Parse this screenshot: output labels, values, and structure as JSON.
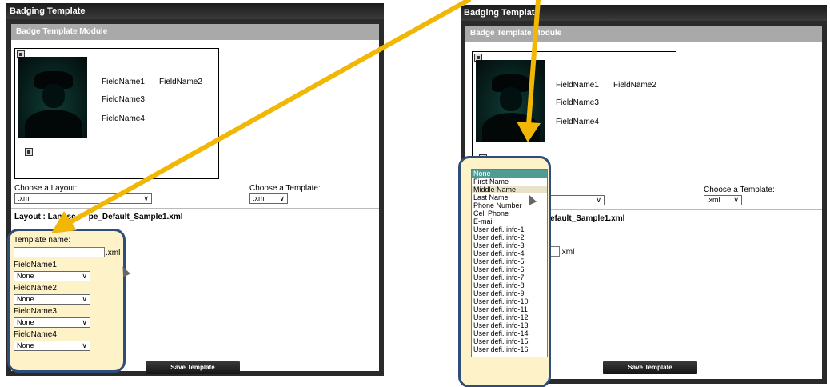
{
  "window_title": "Badging Template",
  "module_title": "Badge Template Module",
  "field_names": [
    "FieldName1",
    "FieldName2",
    "FieldName3",
    "FieldName4"
  ],
  "layout_label": "Choose a Layout:",
  "layout_value": ".xml",
  "template_label": "Choose a Template:",
  "template_value": ".xml",
  "layout_info_left": "Layout : Landsc",
  "layout_info_mid": "pe_Default_Sample1.xml",
  "layout_info_right": "efault_Sample1.xml",
  "template_name_label": "Template name:",
  "template_name_suffix": ".xml",
  "field_select_value": "None",
  "save_button": "Save Template",
  "dropdown_options": [
    "None",
    "First Name",
    "Middle Name",
    "Last Name",
    "Phone Number",
    "Cell Phone",
    "E-mail",
    "User defi. info-1",
    "User defi. info-2",
    "User defi. info-3",
    "User defi. info-4",
    "User defi. info-5",
    "User defi. info-6",
    "User defi. info-7",
    "User defi. info-8",
    "User defi. info-9",
    "User defi. info-10",
    "User defi. info-11",
    "User defi. info-12",
    "User defi. info-13",
    "User defi. info-14",
    "User defi. info-15",
    "User defi. info-16"
  ],
  "colors": {
    "arrow": "#f2b705",
    "callout_border": "#2f4d7a",
    "callout_fill": "#fdf2c8",
    "selected_option": "#4f9c94"
  }
}
